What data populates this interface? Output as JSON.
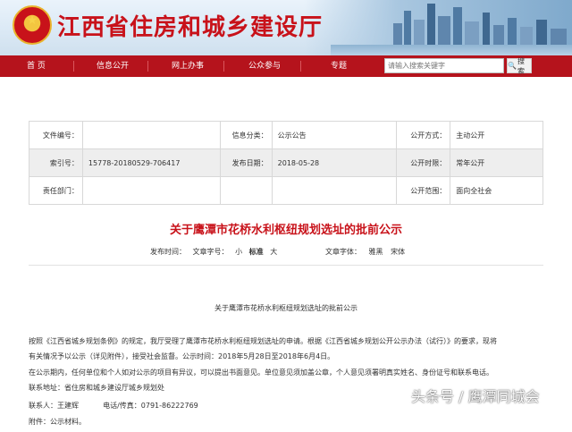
{
  "header": {
    "site_title": "江西省住房和城乡建设厅",
    "colors": {
      "brand_red": "#c8121a",
      "nav_red": "#b5131c"
    }
  },
  "nav": {
    "items": [
      "首 页",
      "信息公开",
      "网上办事",
      "公众参与",
      "专题"
    ],
    "search_placeholder": "请输入搜索关键字",
    "search_button": "搜索",
    "search_icon": "magnifier-icon"
  },
  "meta_table": {
    "row1": {
      "doc_no_label": "文件编号：",
      "doc_no_value": "",
      "category_label": "信息分类：",
      "category_value": "公示公告",
      "disclosure_label": "公开方式：",
      "disclosure_value": "主动公开"
    },
    "row2": {
      "index_label": "索引号：",
      "index_value": "15778-20180529-706417",
      "date_label": "发布日期：",
      "date_value": "2018-05-28",
      "time_label": "公开时限：",
      "time_value": "常年公开"
    },
    "row3": {
      "dept_label": "责任部门：",
      "dept_value": "",
      "scope_label": "公开范围：",
      "scope_value": "面向全社会"
    }
  },
  "article": {
    "title": "关于鹰潭市花桥水利枢纽规划选址的批前公示",
    "source_label": "发布时间：",
    "font_size_label": "文章字号：",
    "size_small": "小",
    "size_normal": "标准",
    "size_large": "大",
    "font_face_label": "文章字体：",
    "face_yahei": "雅黑",
    "face_song": "宋体",
    "subhead": "关于鹰潭市花桥水利枢纽规划选址的批前公示",
    "p1_line1": "按照《江西省城乡规划条例》的规定，我厅受理了鹰潭市花桥水利枢纽规划选址的申请。根据《江西省城乡规划公开公示办法（试行）》的要求，现将",
    "p1_line2": "有关情况予以公示（详见附件），接受社会监督。公示时间：2018年5月28日至2018年6月4日。",
    "p2": "在公示期内，任何单位和个人如对公示的项目有异议，可以提出书面意见。单位意见须加盖公章，个人意见须署明真实姓名、身份证号和联系电话。",
    "address": "联系地址：省住房和城乡建设厅城乡规划处",
    "contact": "联系人：王建辉",
    "phone": "电话/传真：0791-86222769",
    "attachment": "附件：公示材料。"
  },
  "watermark": "头条号 / 鹰潭同城会"
}
